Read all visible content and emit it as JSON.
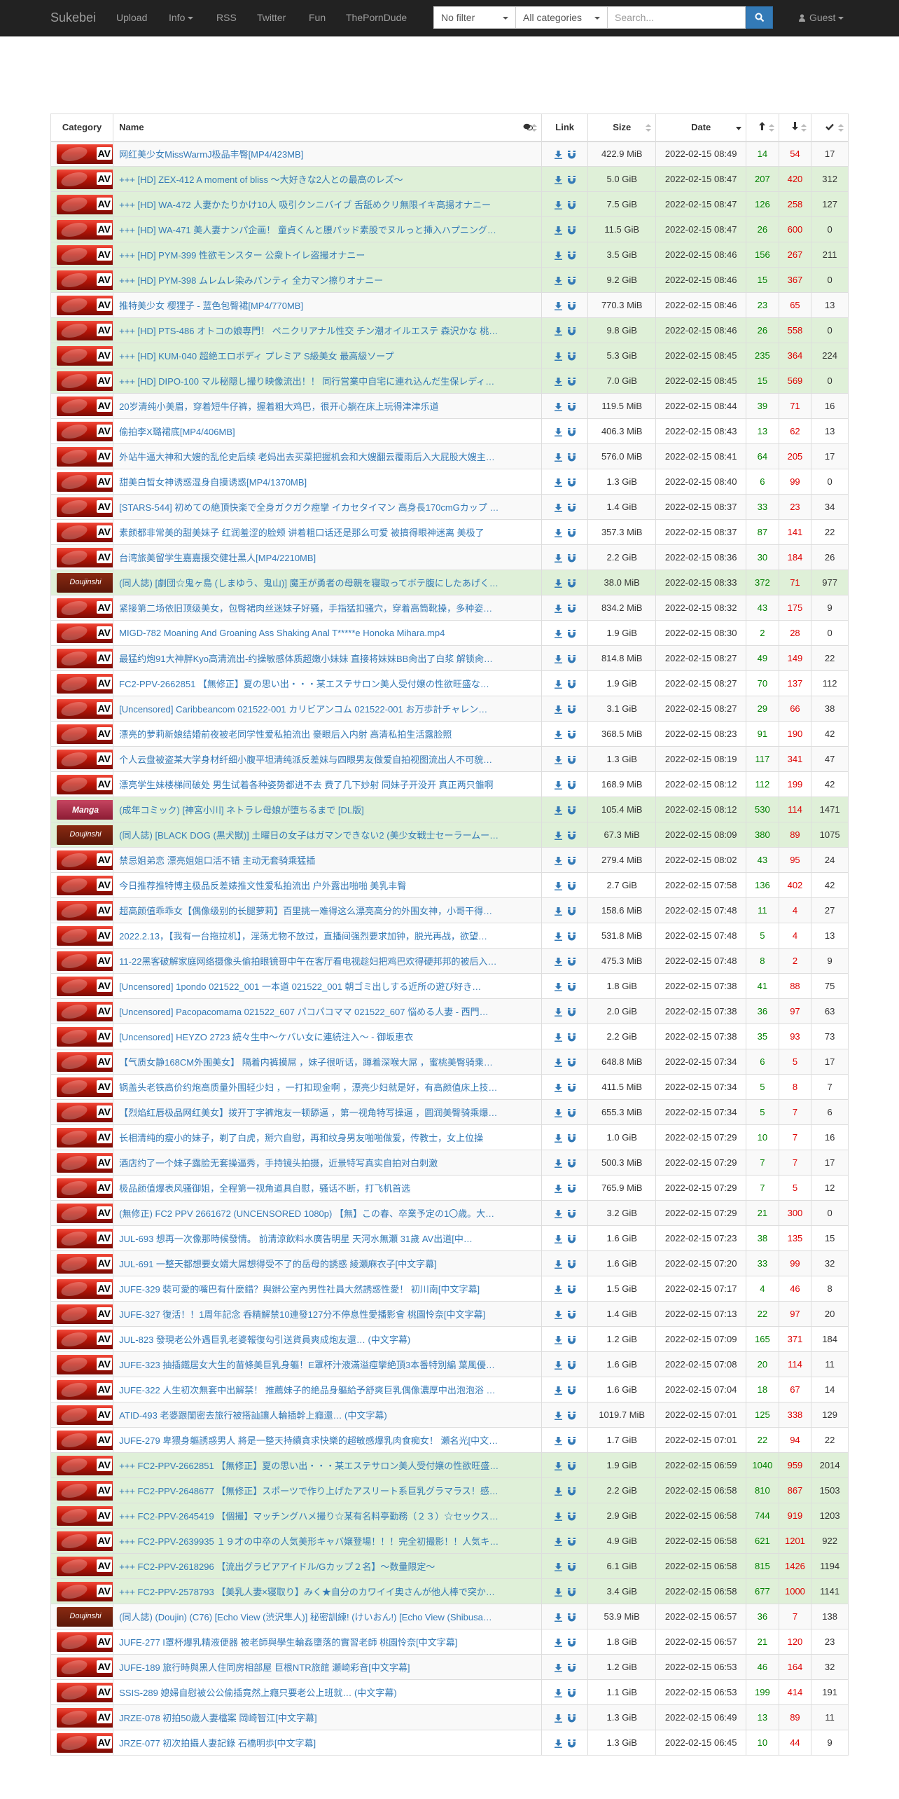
{
  "nav": {
    "brand": "Sukebei",
    "links": [
      "Upload",
      "Info",
      "RSS",
      "Twitter",
      "Fun",
      "ThePornDude"
    ],
    "filter": "No filter",
    "category": "All categories",
    "search_placeholder": "Search...",
    "user": "Guest"
  },
  "table": {
    "headers": {
      "category": "Category",
      "name": "Name",
      "link": "Link",
      "size": "Size",
      "date": "Date"
    },
    "rows": [
      {
        "cat": "av",
        "name": "网红美少女MissWarmJ极品丰臀[MP4/423MB]",
        "size": "422.9 MiB",
        "date": "2022-02-15 08:49",
        "se": "14",
        "le": "54",
        "dl": "17",
        "status": "default"
      },
      {
        "cat": "av",
        "name": "+++ [HD] ZEX-412 A moment of bliss ～大好きな2人との最高のレズ～",
        "size": "5.0 GiB",
        "date": "2022-02-15 08:47",
        "se": "207",
        "le": "420",
        "dl": "312",
        "status": "success"
      },
      {
        "cat": "av",
        "name": "+++ [HD] WA-472 人妻かたりかけ10人 吸引クンニバイブ 舌舐めクリ無限イキ高揚オナニー",
        "size": "7.5 GiB",
        "date": "2022-02-15 08:47",
        "se": "126",
        "le": "258",
        "dl": "127",
        "status": "success"
      },
      {
        "cat": "av",
        "name": "+++ [HD] WA-471 美人妻ナンパ企画！ 童貞くんと腰パッド素股でヌルっと挿入ハプニング…",
        "size": "11.5 GiB",
        "date": "2022-02-15 08:47",
        "se": "26",
        "le": "600",
        "dl": "0",
        "status": "success"
      },
      {
        "cat": "av",
        "name": "+++ [HD] PYM-399 性欲モンスター 公衆トイレ盗撮オナニー",
        "size": "3.5 GiB",
        "date": "2022-02-15 08:46",
        "se": "156",
        "le": "267",
        "dl": "211",
        "status": "success"
      },
      {
        "cat": "av",
        "name": "+++ [HD] PYM-398 ムレムレ染みパンティ 全力マン擦りオナニー",
        "size": "9.2 GiB",
        "date": "2022-02-15 08:46",
        "se": "15",
        "le": "367",
        "dl": "0",
        "status": "success"
      },
      {
        "cat": "av",
        "name": "推特美少女 樱狸子 - 蓝色包臀裙[MP4/770MB]",
        "size": "770.3 MiB",
        "date": "2022-02-15 08:46",
        "se": "23",
        "le": "65",
        "dl": "13",
        "status": "default"
      },
      {
        "cat": "av",
        "name": "+++ [HD] PTS-486 オトコの娘専門！ ペニクリアナル性交 チン潮オイルエステ 森沢かな 桃…",
        "size": "9.8 GiB",
        "date": "2022-02-15 08:46",
        "se": "26",
        "le": "558",
        "dl": "0",
        "status": "success"
      },
      {
        "cat": "av",
        "name": "+++ [HD] KUM-040 超絶エロボディ プレミア S級美女 最高級ソープ",
        "size": "5.3 GiB",
        "date": "2022-02-15 08:45",
        "se": "235",
        "le": "364",
        "dl": "224",
        "status": "success"
      },
      {
        "cat": "av",
        "name": "+++ [HD] DIPO-100 マル秘隠し撮り映像流出！！ 同行営業中自宅に連れ込んだ生保レディ…",
        "size": "7.0 GiB",
        "date": "2022-02-15 08:45",
        "se": "15",
        "le": "569",
        "dl": "0",
        "status": "success"
      },
      {
        "cat": "av",
        "name": "20岁清纯小美眉，穿着短牛仔裤，握着粗大鸡巴，很开心躺在床上玩得津津乐道",
        "size": "119.5 MiB",
        "date": "2022-02-15 08:44",
        "se": "39",
        "le": "71",
        "dl": "16",
        "status": "default"
      },
      {
        "cat": "av",
        "name": "偷拍李X璐裙底[MP4/406MB]",
        "size": "406.3 MiB",
        "date": "2022-02-15 08:43",
        "se": "13",
        "le": "62",
        "dl": "13",
        "status": "default"
      },
      {
        "cat": "av",
        "name": "外站牛逼大神和大嫂的乱伦史后续 老妈出去买菜把握机会和大嫂翻云覆雨后入大屁股大嫂主…",
        "size": "576.0 MiB",
        "date": "2022-02-15 08:41",
        "se": "64",
        "le": "205",
        "dl": "17",
        "status": "default"
      },
      {
        "cat": "av",
        "name": "甜美白皙女神诱惑湿身自摸诱惑[MP4/1370MB]",
        "size": "1.3 GiB",
        "date": "2022-02-15 08:40",
        "se": "6",
        "le": "99",
        "dl": "0",
        "status": "default"
      },
      {
        "cat": "av",
        "name": "[STARS-544] 初めての絶頂快楽で全身ガクガク痙攣 イカセタイマン 高身長170cmGカップ …",
        "size": "1.4 GiB",
        "date": "2022-02-15 08:37",
        "se": "33",
        "le": "23",
        "dl": "34",
        "status": "default"
      },
      {
        "cat": "av",
        "name": "素颜都非常美的甜美妹子 红润羞涩的脸颊 讲着粗口话还是那么可爱 被搞得眼神迷离 美极了",
        "size": "357.3 MiB",
        "date": "2022-02-15 08:37",
        "se": "87",
        "le": "141",
        "dl": "22",
        "status": "default"
      },
      {
        "cat": "av",
        "name": "台湾旅美留学生嘉嘉援交健壮黑人[MP4/2210MB]",
        "size": "2.2 GiB",
        "date": "2022-02-15 08:36",
        "se": "30",
        "le": "184",
        "dl": "26",
        "status": "default"
      },
      {
        "cat": "doujinshi",
        "name": "(同人誌) [劇団☆鬼ヶ島 (しまゆう、鬼山)] 魔王が勇者の母親を寝取ってボテ腹にしたあげく…",
        "size": "38.0 MiB",
        "date": "2022-02-15 08:33",
        "se": "372",
        "le": "71",
        "dl": "977",
        "status": "success"
      },
      {
        "cat": "av",
        "name": "紧接第二场依旧顶级美女，包臀裙肉丝迷妹子好骚，手指猛扣骚穴，穿着高筒靴操，多种姿…",
        "size": "834.2 MiB",
        "date": "2022-02-15 08:32",
        "se": "43",
        "le": "175",
        "dl": "9",
        "status": "default"
      },
      {
        "cat": "av",
        "name": "MIGD-782 Moaning And Groaning Ass Shaking Anal T*****e Honoka Mihara.mp4",
        "size": "1.9 GiB",
        "date": "2022-02-15 08:30",
        "se": "2",
        "le": "28",
        "dl": "0",
        "status": "default"
      },
      {
        "cat": "av",
        "name": "最猛约炮91大神胖Kyo高清流出-约操敏感体质超嫩小妹妹 直接将妹妹BB肏出了白浆 解锁肏…",
        "size": "814.8 MiB",
        "date": "2022-02-15 08:27",
        "se": "49",
        "le": "149",
        "dl": "22",
        "status": "default"
      },
      {
        "cat": "av",
        "name": " FC2-PPV-2662851 【無修正】夏の思い出・・・某エステサロン美人受付嬢の性欲旺盛な…",
        "size": "1.9 GiB",
        "date": "2022-02-15 08:27",
        "se": "70",
        "le": "137",
        "dl": "112",
        "status": "default"
      },
      {
        "cat": "av",
        "name": " [Uncensored] Caribbeancom 021522-001 カリビアンコム 021522-001 お万歩計チャレン…",
        "size": "3.1 GiB",
        "date": "2022-02-15 08:27",
        "se": "29",
        "le": "66",
        "dl": "38",
        "status": "default"
      },
      {
        "cat": "av",
        "name": "漂亮的萝莉新娘结婚前夜被老同学性爱私拍流出 豪眼后入内射 高清私拍生活露脸照",
        "size": "368.5 MiB",
        "date": "2022-02-15 08:23",
        "se": "91",
        "le": "190",
        "dl": "42",
        "status": "default"
      },
      {
        "cat": "av",
        "name": "个人云盘被盗某大学身材纤细小腹平坦清纯派反差妹与四眼男友做爱自拍视图流出人不可貌…",
        "size": "1.3 GiB",
        "date": "2022-02-15 08:19",
        "se": "117",
        "le": "341",
        "dl": "47",
        "status": "default"
      },
      {
        "cat": "av",
        "name": "漂亮学生妹楼梯间破处 男生试着各种姿势都进不去 费了几下妙射 同妹子开没开 真正两只雏啊",
        "size": "168.9 MiB",
        "date": "2022-02-15 08:12",
        "se": "112",
        "le": "199",
        "dl": "42",
        "status": "default"
      },
      {
        "cat": "manga",
        "name": "(成年コミック) [神宮小川] ネトラレ母娘が堕ちるまで [DL版]",
        "size": "105.4 MiB",
        "date": "2022-02-15 08:12",
        "se": "530",
        "le": "114",
        "dl": "1471",
        "status": "success"
      },
      {
        "cat": "doujinshi",
        "name": "(同人誌) [BLACK DOG (黒犬獣)] 土曜日の女子はガマンできない2 (美少女戦士セーラームー…",
        "size": "67.3 MiB",
        "date": "2022-02-15 08:09",
        "se": "380",
        "le": "89",
        "dl": "1075",
        "status": "success"
      },
      {
        "cat": "av",
        "name": "禁忌姐弟恋 漂亮姐姐口活不错 主动无套骑乘猛插",
        "size": "279.4 MiB",
        "date": "2022-02-15 08:02",
        "se": "43",
        "le": "95",
        "dl": "24",
        "status": "default"
      },
      {
        "cat": "av",
        "name": "今日推荐推特博主极品反差婊推文性爱私拍流出 户外露出啪啪 美乳丰臀",
        "size": "2.7 GiB",
        "date": "2022-02-15 07:58",
        "se": "136",
        "le": "402",
        "dl": "42",
        "status": "default"
      },
      {
        "cat": "av",
        "name": "超高颜值乖乖女【偶像级别的长腿萝莉】百里挑一难得这么漂亮高分的外围女神，小哥干得…",
        "size": "158.6 MiB",
        "date": "2022-02-15 07:48",
        "se": "11",
        "le": "4",
        "dl": "27",
        "status": "default"
      },
      {
        "cat": "av",
        "name": "2022.2.13，【我有一台拖拉机】，淫荡尤物不放过，直播间强烈要求加钟，脱光再战，欲望…",
        "size": "531.8 MiB",
        "date": "2022-02-15 07:48",
        "se": "5",
        "le": "4",
        "dl": "13",
        "status": "default"
      },
      {
        "cat": "av",
        "name": "11-22黑客破解家庭网络摄像头偷拍眼镜哥中午在客厅看电视趁妇把鸡巴欢得硬邦邦的被后入…",
        "size": "475.3 MiB",
        "date": "2022-02-15 07:48",
        "se": "8",
        "le": "2",
        "dl": "9",
        "status": "default"
      },
      {
        "cat": "av",
        "name": " [Uncensored] 1pondo 021522_001 一本道 021522_001 朝ゴミ出しする近所の遊び好き…",
        "size": "1.8 GiB",
        "date": "2022-02-15 07:38",
        "se": "41",
        "le": "88",
        "dl": "75",
        "status": "default"
      },
      {
        "cat": "av",
        "name": " [Uncensored] Pacopacomama 021522_607 パコパコママ 021522_607 悩める人妻 - 西門…",
        "size": "2.0 GiB",
        "date": "2022-02-15 07:38",
        "se": "36",
        "le": "97",
        "dl": "63",
        "status": "default"
      },
      {
        "cat": "av",
        "name": " [Uncensored] HEYZO 2723 続々生中～ケバい女に連続注入～ - 御坂恵衣",
        "size": "2.2 GiB",
        "date": "2022-02-15 07:38",
        "se": "35",
        "le": "93",
        "dl": "73",
        "status": "default"
      },
      {
        "cat": "av",
        "name": "【气质女静168CM外围美女】 隔着内裤摸屌 ，妹子很听话，蹲着深喉大屌 ，蜜桃美臀骑乘…",
        "size": "648.8 MiB",
        "date": "2022-02-15 07:34",
        "se": "6",
        "le": "5",
        "dl": "17",
        "status": "default"
      },
      {
        "cat": "av",
        "name": "锅盖头老铁高价约炮高质量外围轻少妇 ，一打扣现金啊 ，漂亮少妇就是好，有高颜值床上技…",
        "size": "411.5 MiB",
        "date": "2022-02-15 07:34",
        "se": "5",
        "le": "8",
        "dl": "7",
        "status": "default"
      },
      {
        "cat": "av",
        "name": "【烈焰红唇极品网红美女】拨开丁字裤炮友一顿舔逼 ，第一视角特写操逼 ，圆润美臀骑乘爆…",
        "size": "655.3 MiB",
        "date": "2022-02-15 07:34",
        "se": "5",
        "le": "7",
        "dl": "6",
        "status": "default"
      },
      {
        "cat": "av",
        "name": "长相清纯的瘦小的妹子，剃了白虎，掰穴自慰，再和纹身男友啪啪做爱，传教士，女上位操",
        "size": "1.0 GiB",
        "date": "2022-02-15 07:29",
        "se": "10",
        "le": "7",
        "dl": "16",
        "status": "default"
      },
      {
        "cat": "av",
        "name": "酒店约了一个妹子露脸无套操逼秀，手持镜头拍摄，近景特写真实自拍对白刺激",
        "size": "500.3 MiB",
        "date": "2022-02-15 07:29",
        "se": "7",
        "le": "7",
        "dl": "17",
        "status": "default"
      },
      {
        "cat": "av",
        "name": "极品颜值爆表风骚御姐，全程第一视角道具自慰，骚话不断，打飞机首选",
        "size": "765.9 MiB",
        "date": "2022-02-15 07:29",
        "se": "7",
        "le": "5",
        "dl": "12",
        "status": "default"
      },
      {
        "cat": "av",
        "name": "(無修正) FC2 PPV 2661672 (UNCENSORED 1080p) 【無】この春、卒業予定の1〇歳。大…",
        "size": "3.2 GiB",
        "date": "2022-02-15 07:29",
        "se": "21",
        "le": "300",
        "dl": "0",
        "status": "default"
      },
      {
        "cat": "av",
        "name": "JUL-693 想再一次像那時候發情。 前清涼飲料水廣告明星 天河水無瀬 31歲 AV出道[中…",
        "size": "1.6 GiB",
        "date": "2022-02-15 07:23",
        "se": "38",
        "le": "135",
        "dl": "15",
        "status": "default"
      },
      {
        "cat": "av",
        "name": "JUL-691 一整天都想要女婿大屌想得受不了的岳母的誘惑 綾瀬麻衣子[中文字幕]",
        "size": "1.6 GiB",
        "date": "2022-02-15 07:20",
        "se": "33",
        "le": "99",
        "dl": "32",
        "status": "default"
      },
      {
        "cat": "av",
        "name": "JUFE-329 裝可愛的嘴巴有什麼錯？與辦公室內男性社員大然誘惑性愛！ 初川南[中文字幕]",
        "size": "1.5 GiB",
        "date": "2022-02-15 07:17",
        "se": "4",
        "le": "46",
        "dl": "8",
        "status": "default"
      },
      {
        "cat": "av",
        "name": "JUFE-327 復活！！1周年記念 呑精解禁10連發127分不停息性愛播影會 桃園怜奈[中文字幕]",
        "size": "1.4 GiB",
        "date": "2022-02-15 07:13",
        "se": "22",
        "le": "97",
        "dl": "20",
        "status": "default"
      },
      {
        "cat": "av",
        "name": "JUL-823 發現老公外遇巨乳老婆報復勾引送貨員爽成炮友還… (中文字幕)",
        "size": "1.2 GiB",
        "date": "2022-02-15 07:09",
        "se": "165",
        "le": "371",
        "dl": "184",
        "status": "default"
      },
      {
        "cat": "av",
        "name": "JUFE-323 抽插鐵居女大生的苗條美巨乳身軀！E罩杯汁液滿溢痙攣絶頂3本番特別編 葉風優…",
        "size": "1.6 GiB",
        "date": "2022-02-15 07:08",
        "se": "20",
        "le": "114",
        "dl": "11",
        "status": "default"
      },
      {
        "cat": "av",
        "name": "JUFE-322 人生初次無套中出解禁！ 推薦妹子的絶品身軀給予舒爽巨乳偶像濃厚中出泡泡浴 …",
        "size": "1.6 GiB",
        "date": "2022-02-15 07:04",
        "se": "18",
        "le": "67",
        "dl": "14",
        "status": "default"
      },
      {
        "cat": "av",
        "name": "ATID-493 老婆跟閨密去旅行被搭訕讓人輪插幹上癮還… (中文字幕)",
        "size": "1019.7 MiB",
        "date": "2022-02-15 07:01",
        "se": "125",
        "le": "338",
        "dl": "129",
        "status": "default"
      },
      {
        "cat": "av",
        "name": "JUFE-279 卑猥身軀誘惑男人 將是一整天持續貪求快樂的超敏感爆乳肉食痴女！ 瀬名光[中文…",
        "size": "1.7 GiB",
        "date": "2022-02-15 07:01",
        "se": "22",
        "le": "94",
        "dl": "22",
        "status": "default"
      },
      {
        "cat": "av",
        "name": "+++ FC2-PPV-2662851 【無修正】夏の思い出・・・某エステサロン美人受付嬢の性欲旺盛…",
        "size": "1.9 GiB",
        "date": "2022-02-15 06:59",
        "se": "1040",
        "le": "959",
        "dl": "2014",
        "status": "success"
      },
      {
        "cat": "av",
        "name": "+++ FC2-PPV-2648677 【無修正】スポーツで作り上げたアスリート系巨乳グラマラス！感…",
        "size": "2.2 GiB",
        "date": "2022-02-15 06:58",
        "se": "810",
        "le": "867",
        "dl": "1503",
        "status": "success"
      },
      {
        "cat": "av",
        "name": "+++ FC2-PPV-2645419 【個撮】マッチングハメ撮り☆某有名料亭勤務（２３）☆セックス…",
        "size": "2.9 GiB",
        "date": "2022-02-15 06:58",
        "se": "744",
        "le": "919",
        "dl": "1203",
        "status": "success"
      },
      {
        "cat": "av",
        "name": "+++ FC2-PPV-2639935 １９才の中卒の人気美形キャバ嬢登場！！！完全初撮影！！人気キ…",
        "size": "4.9 GiB",
        "date": "2022-02-15 06:58",
        "se": "621",
        "le": "1201",
        "dl": "922",
        "status": "success"
      },
      {
        "cat": "av",
        "name": "+++ FC2-PPV-2618296 【流出グラビアアイドル/Gカップ２名】～数量限定～",
        "size": "6.1 GiB",
        "date": "2022-02-15 06:58",
        "se": "815",
        "le": "1426",
        "dl": "1194",
        "status": "success"
      },
      {
        "cat": "av",
        "name": "+++ FC2-PPV-2578793 【美乳人妻×寝取り】みく★自分のカワイイ奥さんが他人棒で突か…",
        "size": "3.4 GiB",
        "date": "2022-02-15 06:58",
        "se": "677",
        "le": "1000",
        "dl": "1141",
        "status": "success"
      },
      {
        "cat": "doujinshi",
        "name": "(同人誌) (Doujin) (C76) [Echo View (渋沢隼人)] 秘密訓練! (けいおん!) [Echo View (Shibusa…",
        "size": "53.9 MiB",
        "date": "2022-02-15 06:57",
        "se": "36",
        "le": "7",
        "dl": "138",
        "status": "default"
      },
      {
        "cat": "av",
        "name": "JUFE-277 I罩杯爆乳精液便器 被老師與學生輪姦墮落的實習老師 桃園怜奈[中文字幕]",
        "size": "1.8 GiB",
        "date": "2022-02-15 06:57",
        "se": "21",
        "le": "120",
        "dl": "23",
        "status": "default"
      },
      {
        "cat": "av",
        "name": "JUFE-189 旅行時與黑人住同房相部屋 巨根NTR旅館 瀬崎彩音[中文字幕]",
        "size": "1.2 GiB",
        "date": "2022-02-15 06:53",
        "se": "46",
        "le": "164",
        "dl": "32",
        "status": "default"
      },
      {
        "cat": "av",
        "name": "SSIS-289 媳婦自慰被公公偷插竟然上癮只要老公上班就… (中文字幕)",
        "size": "1.1 GiB",
        "date": "2022-02-15 06:53",
        "se": "199",
        "le": "414",
        "dl": "191",
        "status": "default"
      },
      {
        "cat": "av",
        "name": "JRZE-078 初拍50歳人妻檔案 岡崎智江[中文字幕]",
        "size": "1.3 GiB",
        "date": "2022-02-15 06:49",
        "se": "13",
        "le": "89",
        "dl": "11",
        "status": "default"
      },
      {
        "cat": "av",
        "name": "JRZE-077 初次拍攝人妻記錄 石橋明歩[中文字幕]",
        "size": "1.3 GiB",
        "date": "2022-02-15 06:45",
        "se": "10",
        "le": "44",
        "dl": "9",
        "status": "default"
      }
    ]
  }
}
